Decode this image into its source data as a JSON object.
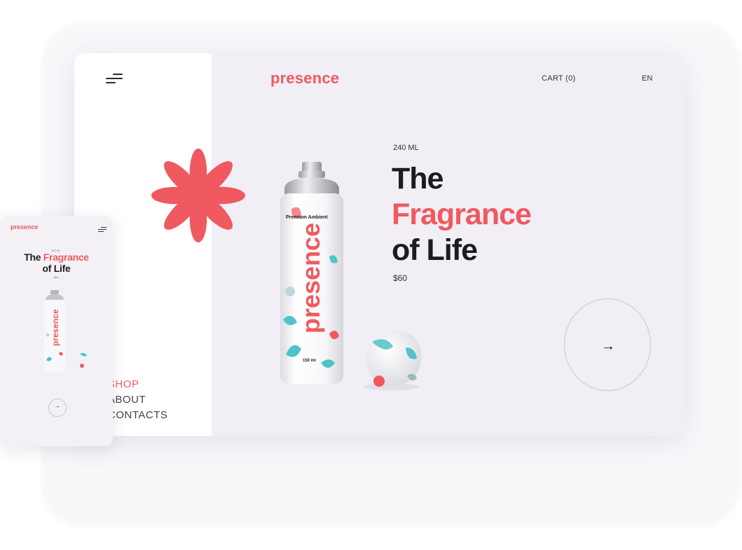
{
  "desktop": {
    "brand": "presence",
    "cart_label": "CART (0)",
    "language": "EN",
    "nav": {
      "shop": "SHOP",
      "about": "ABOUT",
      "contacts": "CONTACTS"
    },
    "product": {
      "volume": "240 ML",
      "title_line1": "The",
      "title_line2": "Fragrance",
      "title_line3": "of Life",
      "price": "$60",
      "can_brand": "presence",
      "can_label": "Premium Ambient",
      "can_volume": "150 ml"
    },
    "next_arrow": "→"
  },
  "mobile": {
    "brand": "presence",
    "volume": "240 ML",
    "title_part1": "The",
    "title_part2": "Fragrance",
    "title_line2": "of Life",
    "price": "$60",
    "next_arrow": "→"
  },
  "colors": {
    "accent": "#f0595f",
    "background": "#f1eef5",
    "teal": "#4fc3c7"
  },
  "icons": [
    "menu-icon",
    "flower-icon",
    "arrow-right-icon"
  ]
}
